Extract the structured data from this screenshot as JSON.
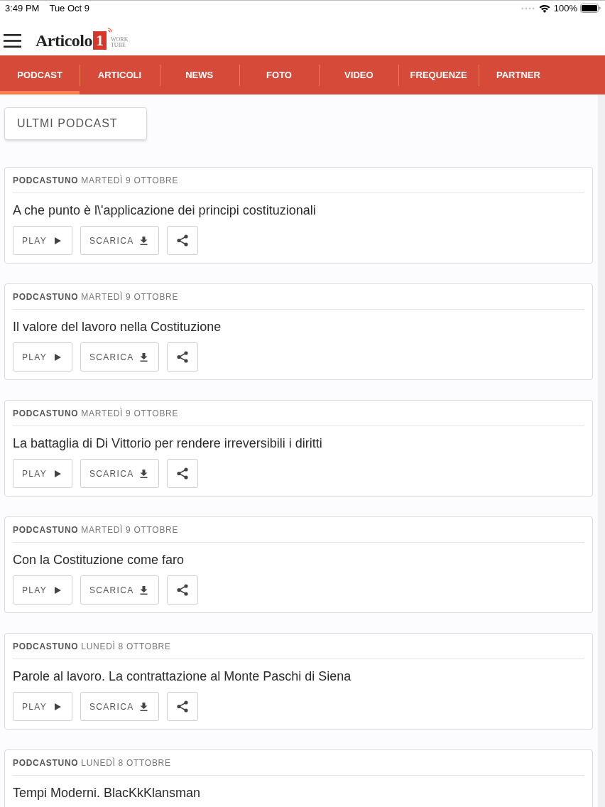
{
  "status_bar": {
    "time": "3:49 PM",
    "date": "Tue Oct 9",
    "battery": "100%"
  },
  "header": {
    "logo": {
      "name": "Articolo",
      "number": "1",
      "tagline_top": "WORK",
      "tagline_bottom": "TUBE"
    }
  },
  "tabs": [
    {
      "label": "PODCAST",
      "selected": true
    },
    {
      "label": "ARTICOLI",
      "selected": false
    },
    {
      "label": "NEWS",
      "selected": false
    },
    {
      "label": "FOTO",
      "selected": false
    },
    {
      "label": "VIDEO",
      "selected": false
    },
    {
      "label": "FREQUENZE",
      "selected": false
    },
    {
      "label": "PARTNER",
      "selected": false
    }
  ],
  "section_button": "ULTMI PODCAST",
  "episodes": [
    {
      "source": "PODCASTUNO",
      "date": "MARTEDÌ 9 OTTOBRE",
      "title": "A che punto è l\\'applicazione dei principi costituzionali",
      "actions": [
        {
          "kind": "play",
          "label": "PLAY"
        },
        {
          "kind": "download",
          "label": "SCARICA"
        },
        {
          "kind": "share"
        }
      ]
    },
    {
      "source": "PODCASTUNO",
      "date": "MARTEDÌ 9 OTTOBRE",
      "title": "Il valore del lavoro nella Costituzione",
      "actions": [
        {
          "kind": "play",
          "label": "PLAY"
        },
        {
          "kind": "download",
          "label": "SCARICA"
        },
        {
          "kind": "share"
        }
      ]
    },
    {
      "source": "PODCASTUNO",
      "date": "MARTEDÌ 9 OTTOBRE",
      "title": "La battaglia di Di Vittorio per rendere irreversibili i diritti",
      "actions": [
        {
          "kind": "play",
          "label": "PLAY"
        },
        {
          "kind": "download",
          "label": "SCARICA"
        },
        {
          "kind": "share"
        }
      ]
    },
    {
      "source": "PODCASTUNO",
      "date": "MARTEDÌ 9 OTTOBRE",
      "title": "Con la Costituzione come faro",
      "actions": [
        {
          "kind": "play",
          "label": "PLAY"
        },
        {
          "kind": "download",
          "label": "SCARICA"
        },
        {
          "kind": "share"
        }
      ]
    },
    {
      "source": "PODCASTUNO",
      "date": "LUNEDÌ 8 OTTOBRE",
      "title": "Parole al lavoro. La contrattazione al Monte Paschi di Siena",
      "actions": [
        {
          "kind": "play",
          "label": "PLAY"
        },
        {
          "kind": "download",
          "label": "SCARICA"
        },
        {
          "kind": "share"
        }
      ]
    },
    {
      "source": "PODCASTUNO",
      "date": "LUNEDÌ 8 OTTOBRE",
      "title": "Tempi Moderni. BlacKkKlansman"
    }
  ]
}
